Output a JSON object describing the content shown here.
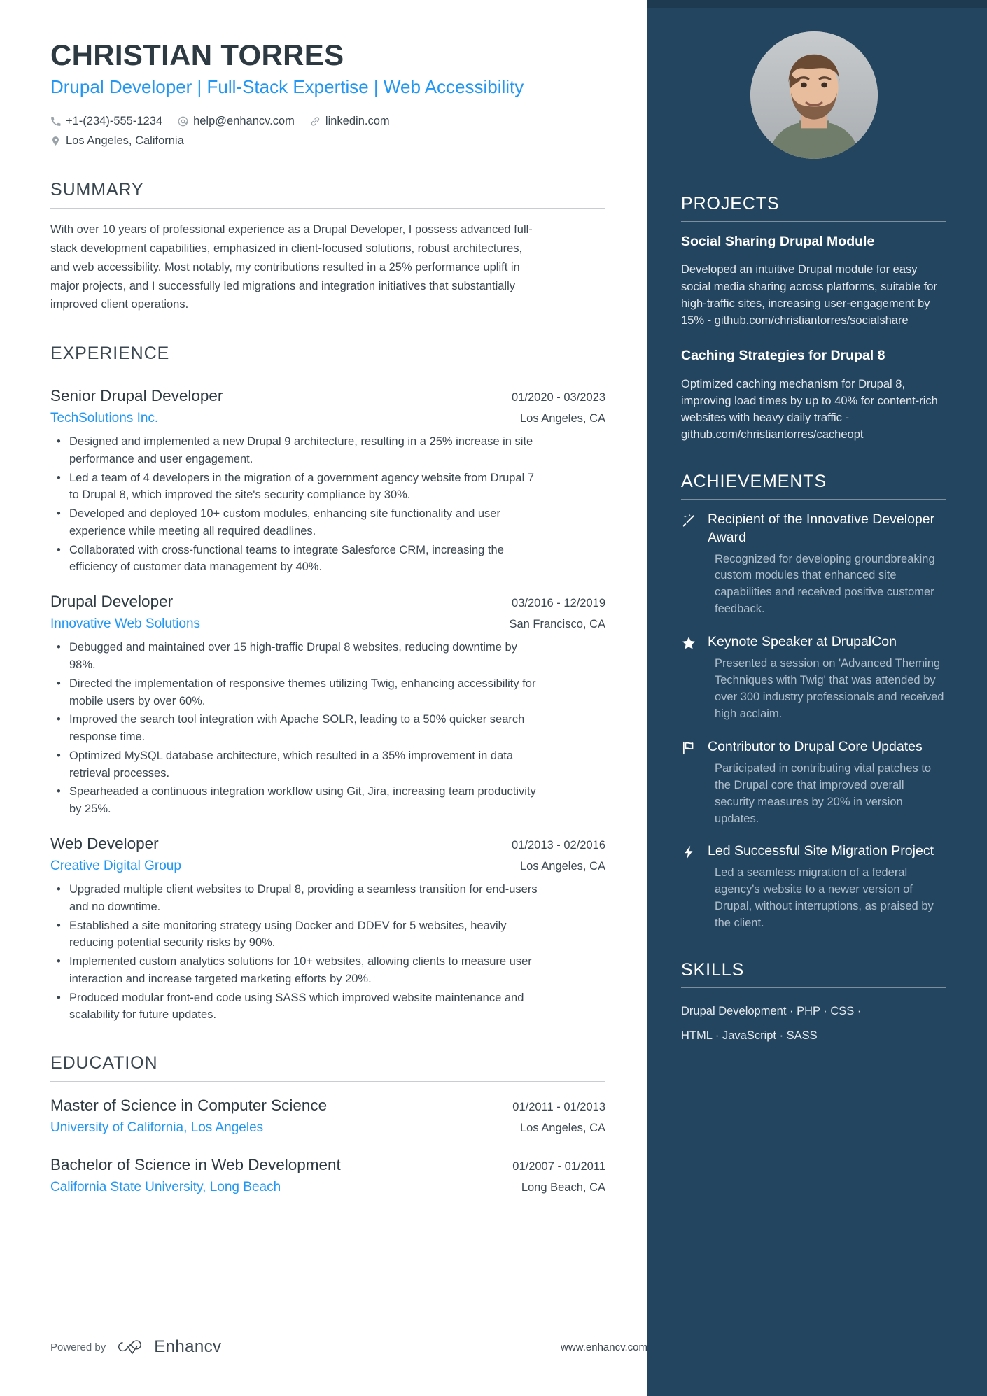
{
  "header": {
    "name": "CHRISTIAN TORRES",
    "headline": "Drupal Developer | Full-Stack Expertise | Web Accessibility",
    "contacts": [
      {
        "icon": "phone-icon",
        "text": "+1-(234)-555-1234"
      },
      {
        "icon": "email-icon",
        "text": "help@enhancv.com"
      },
      {
        "icon": "link-icon",
        "text": "linkedin.com"
      }
    ],
    "location": {
      "icon": "location-pin-icon",
      "text": "Los Angeles, California"
    }
  },
  "summary": {
    "title": "SUMMARY",
    "text": "With over 10 years of professional experience as a Drupal Developer, I possess advanced full-stack development capabilities, emphasized in client-focused solutions, robust architectures, and web accessibility. Most notably, my contributions resulted in a 25% performance uplift in major projects, and I successfully led migrations and integration initiatives that substantially improved client operations."
  },
  "experience": {
    "title": "EXPERIENCE",
    "entries": [
      {
        "role": "Senior Drupal Developer",
        "dates": "01/2020 - 03/2023",
        "company": "TechSolutions Inc.",
        "location": "Los Angeles, CA",
        "bullets": [
          "Designed and implemented a new Drupal 9 architecture, resulting in a 25% increase in site performance and user engagement.",
          "Led a team of 4 developers in the migration of a government agency website from Drupal 7 to Drupal 8, which improved the site's security compliance by 30%.",
          "Developed and deployed 10+ custom modules, enhancing site functionality and user experience while meeting all required deadlines.",
          "Collaborated with cross-functional teams to integrate Salesforce CRM, increasing the efficiency of customer data management by 40%."
        ]
      },
      {
        "role": "Drupal Developer",
        "dates": "03/2016 - 12/2019",
        "company": "Innovative Web Solutions",
        "location": "San Francisco, CA",
        "bullets": [
          "Debugged and maintained over 15 high-traffic Drupal 8 websites, reducing downtime by 98%.",
          "Directed the implementation of responsive themes utilizing Twig, enhancing accessibility for mobile users by over 60%.",
          "Improved the search tool integration with Apache SOLR, leading to a 50% quicker search response time.",
          "Optimized MySQL database architecture, which resulted in a 35% improvement in data retrieval processes.",
          "Spearheaded a continuous integration workflow using Git, Jira, increasing team productivity by 25%."
        ]
      },
      {
        "role": "Web Developer",
        "dates": "01/2013 - 02/2016",
        "company": "Creative Digital Group",
        "location": "Los Angeles, CA",
        "bullets": [
          "Upgraded multiple client websites to Drupal 8, providing a seamless transition for end-users and no downtime.",
          "Established a site monitoring strategy using Docker and DDEV for 5 websites, heavily reducing potential security risks by 90%.",
          "Implemented custom analytics solutions for 10+ websites, allowing clients to measure user interaction and increase targeted marketing efforts by 20%.",
          "Produced modular front-end code using SASS which improved website maintenance and scalability for future updates."
        ]
      }
    ]
  },
  "education": {
    "title": "EDUCATION",
    "entries": [
      {
        "degree": "Master of Science in Computer Science",
        "dates": "01/2011 - 01/2013",
        "school": "University of California, Los Angeles",
        "location": "Los Angeles, CA"
      },
      {
        "degree": "Bachelor of Science in Web Development",
        "dates": "01/2007 - 01/2011",
        "school": "California State University, Long Beach",
        "location": "Long Beach, CA"
      }
    ]
  },
  "projects": {
    "title": "PROJECTS",
    "items": [
      {
        "name": "Social Sharing Drupal Module",
        "description": "Developed an intuitive Drupal module for easy social media sharing across platforms, suitable for high-traffic sites, increasing user-engagement by 15% - github.com/christiantorres/socialshare"
      },
      {
        "name": "Caching Strategies for Drupal 8",
        "description": "Optimized caching mechanism for Drupal 8, improving load times by up to 40% for content-rich websites with heavy daily traffic - github.com/christiantorres/cacheopt"
      }
    ]
  },
  "achievements": {
    "title": "ACHIEVEMENTS",
    "items": [
      {
        "icon": "magic-wand-icon",
        "title": "Recipient of the Innovative Developer Award",
        "description": "Recognized for developing groundbreaking custom modules that enhanced site capabilities and received positive customer feedback."
      },
      {
        "icon": "star-icon",
        "title": "Keynote Speaker at DrupalCon",
        "description": "Presented a session on 'Advanced Theming Techniques with Twig' that was attended by over 300 industry professionals and received high acclaim."
      },
      {
        "icon": "flag-icon",
        "title": "Contributor to Drupal Core Updates",
        "description": "Participated in contributing vital patches to the Drupal core that improved overall security measures by 20% in version updates."
      },
      {
        "icon": "lightning-bolt-icon",
        "title": "Led Successful Site Migration Project",
        "description": "Led a seamless migration of a federal agency's website to a newer version of Drupal, without interruptions, as praised by the client."
      }
    ]
  },
  "skills": {
    "title": "SKILLS",
    "lines": [
      "Drupal Development · PHP · CSS ·",
      "HTML · JavaScript · SASS"
    ]
  },
  "footer": {
    "powered_by": "Powered by",
    "brand": "Enhancv",
    "url": "www.enhancv.com"
  },
  "colors": {
    "accent_blue": "#2196f3",
    "sidebar_bg": "#24455f",
    "text_dark": "#3b4750"
  }
}
